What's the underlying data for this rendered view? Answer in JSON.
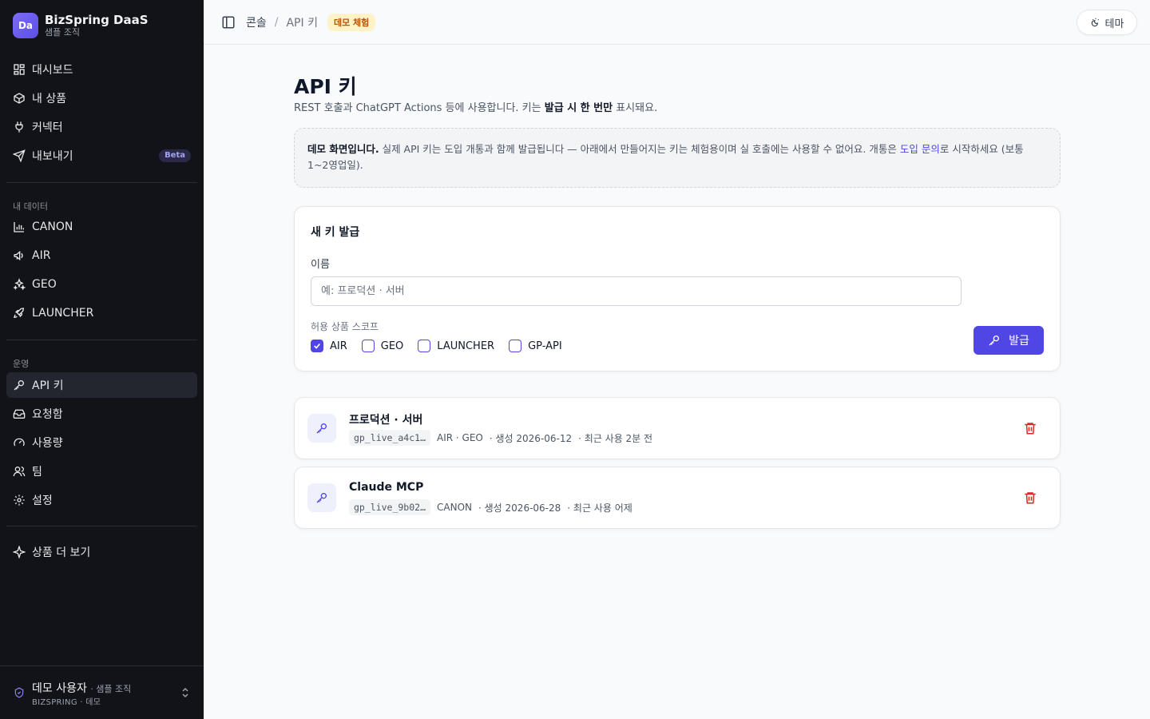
{
  "brand": {
    "logo": "Da",
    "name": "BizSpring DaaS",
    "org": "샘플 조직"
  },
  "nav": {
    "main": [
      {
        "label": "대시보드",
        "icon": "dashboard-icon"
      },
      {
        "label": "내 상품",
        "icon": "package-icon"
      },
      {
        "label": "커넥터",
        "icon": "plug-icon"
      },
      {
        "label": "내보내기",
        "icon": "send-icon",
        "badge": "Beta"
      }
    ],
    "data_label": "내 데이터",
    "data": [
      {
        "label": "CANON",
        "icon": "bar-chart-icon"
      },
      {
        "label": "AIR",
        "icon": "megaphone-icon"
      },
      {
        "label": "GEO",
        "icon": "sparkles-icon"
      },
      {
        "label": "LAUNCHER",
        "icon": "rocket-icon"
      }
    ],
    "ops_label": "운영",
    "ops": [
      {
        "label": "API 키",
        "icon": "key-icon",
        "active": true
      },
      {
        "label": "요청함",
        "icon": "inbox-icon"
      },
      {
        "label": "사용량",
        "icon": "gauge-icon"
      },
      {
        "label": "팀",
        "icon": "users-icon"
      },
      {
        "label": "설정",
        "icon": "gear-icon"
      }
    ],
    "more": {
      "label": "상품 더 보기",
      "icon": "sparkle-icon"
    }
  },
  "user": {
    "name": "데모 사용자",
    "org": "· 샘플 조직",
    "meta": "BIZSPRING · 데모"
  },
  "topbar": {
    "crumb_root": "콘솔",
    "crumb_sep": "/",
    "crumb_current": "API 키",
    "badge": "데모 체험",
    "theme_label": "테마"
  },
  "page": {
    "title": "API 키",
    "desc_pre": "REST 호출과 ChatGPT Actions 등에 사용합니다. 키는 ",
    "desc_bold": "발급 시 한 번만",
    "desc_post": " 표시돼요."
  },
  "notice": {
    "bold": "데모 화면입니다.",
    "text": " 실제 API 키는 도입 개통과 함께 발급됩니다 — 아래에서 만들어지는 키는 체험용이며 실 호출에는 사용할 수 없어요. 개통은 ",
    "link": "도입 문의",
    "text_post": "로 시작하세요 (보통 1~2영업일)."
  },
  "new_key": {
    "title": "새 키 발급",
    "name_label": "이름",
    "name_placeholder": "예: 프로덕션 · 서버",
    "scope_label": "허용 상품 스코프",
    "scopes": [
      {
        "label": "AIR",
        "checked": true
      },
      {
        "label": "GEO",
        "checked": false
      },
      {
        "label": "LAUNCHER",
        "checked": false
      },
      {
        "label": "GP-API",
        "checked": false
      }
    ],
    "issue_label": "발급"
  },
  "keys": [
    {
      "name": "프로덕션 · 서버",
      "prefix": "gp_live_a4c1…",
      "scopes": "AIR · GEO",
      "created": "· 생성 2026-06-12",
      "last_used": "· 최근 사용 2분 전"
    },
    {
      "name": "Claude MCP",
      "prefix": "gp_live_9b02…",
      "scopes": "CANON",
      "created": "· 생성 2026-06-28",
      "last_used": "· 최근 사용 어제"
    }
  ],
  "colors": {
    "accent": "#4f46e5",
    "sidebar_bg": "#111318",
    "danger": "#dc2626",
    "badge_bg": "#fef3c7"
  }
}
